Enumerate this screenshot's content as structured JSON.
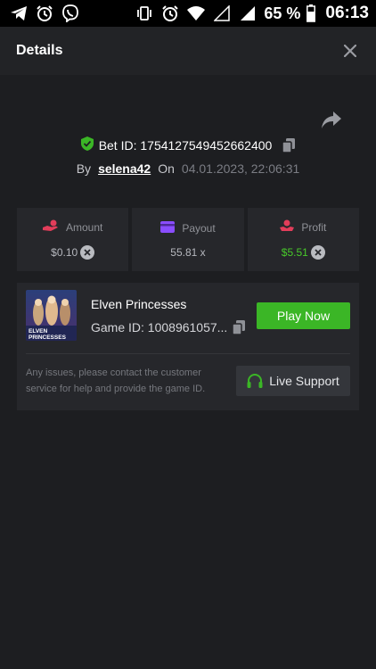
{
  "status_bar": {
    "left_icons": [
      "telegram-icon",
      "alarm-icon",
      "viber-icon"
    ],
    "right_icons": [
      "vibrate-icon",
      "alarm-icon",
      "wifi-icon",
      "signal-empty-icon",
      "signal-icon",
      "battery-icon"
    ],
    "battery": "65 %",
    "time": "06:13"
  },
  "header": {
    "title": "Details",
    "close_icon": "close-icon"
  },
  "bet": {
    "share_icon": "share-icon",
    "shield_icon": "shield-check-icon",
    "bet_id_text": "Bet ID: 1754127549452662400",
    "by_label": "By",
    "username": "selena42",
    "on_label": "On",
    "date": "04.01.2023, 22:06:31"
  },
  "stats": [
    {
      "label": "Amount",
      "value": "$0.10",
      "icon": "hand-coins-icon",
      "coin": true
    },
    {
      "label": "Payout",
      "value": "55.81 x",
      "icon": "card-icon",
      "coin": false
    },
    {
      "label": "Profit",
      "value": "$5.51",
      "icon": "hand-profit-icon",
      "coin": true
    }
  ],
  "game": {
    "name": "Elven Princesses",
    "game_id": "Game ID: 1008961057...",
    "play_label": "Play Now",
    "thumb_text_line1": "ELVEN",
    "thumb_text_line2": "PRINCESSES",
    "issues_text": "Any issues, please contact the customer service for help and provide the game ID.",
    "support_label": "Live Support"
  },
  "colors": {
    "background": "#1d1e21",
    "card": "#26272b",
    "green": "#3bb626",
    "profit_green": "#48c92a",
    "accent_red": "#e23d5a",
    "accent_purple": "#8a4dff"
  }
}
